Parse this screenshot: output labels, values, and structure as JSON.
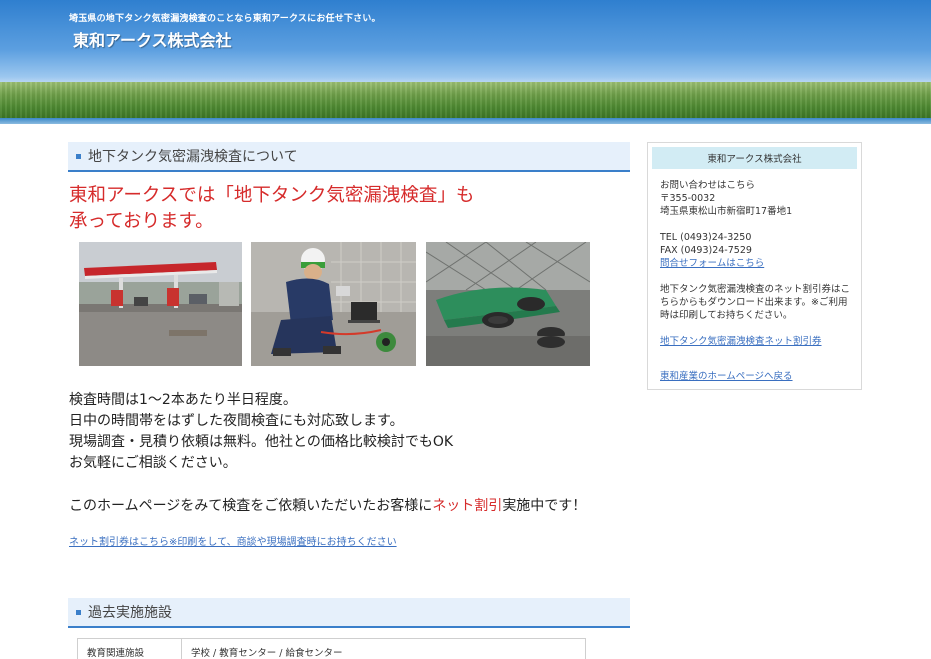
{
  "header": {
    "tagline": "埼玉県の地下タンク気密漏洩検査のことなら東和アークスにお任せ下さい。",
    "site_title": "東和アークス株式会社"
  },
  "main": {
    "section1_heading": "地下タンク気密漏洩検査について",
    "headline_line1": "東和アークスでは「地下タンク気密漏洩検査」も",
    "headline_line2": "承っております。",
    "photos": [
      {
        "name": "gas-station-photo"
      },
      {
        "name": "inspection-worker-photo"
      },
      {
        "name": "tank-covers-photo"
      }
    ],
    "body_lines": [
      "検査時間は1～2本あたり半日程度。",
      "日中の時間帯をはずした夜間検査にも対応致します。",
      "現場調査・見積り依頼は無料。他社との価格比較検討でもOK",
      "お気軽にご相談ください。"
    ],
    "promo_before": "このホームページをみて検査をご依頼いただいたお客様に",
    "promo_highlight": "ネット割引",
    "promo_after": "実施中です！",
    "coupon_link": "ネット割引券はこちら※印刷をして、商談や現場調査時にお持ちください",
    "section2_heading": "過去実施施設",
    "facilities": [
      {
        "category": "教育関連施設",
        "detail": "学校 / 教育センター / 給食センター"
      }
    ]
  },
  "sidebar": {
    "title": "東和アークス株式会社",
    "contact_label": "お問い合わせはこちら",
    "postal": "〒355-0032",
    "address": "埼玉県東松山市新宿町17番地1",
    "tel": "TEL (0493)24-3250",
    "fax": "FAX (0493)24-7529",
    "form_link": "問合せフォームはこちら",
    "coupon_note_1": "地下タンク気密漏洩検査のネット割引券はこ",
    "coupon_note_2": "ちらからもダウンロード出来ます。※ご利用",
    "coupon_note_3": "時は印刷してお持ちください。",
    "coupon_link": "地下タンク気密漏洩検査ネット割引券",
    "home_link": "東和産業のホームページへ戻る"
  },
  "colors": {
    "accent_blue": "#3a7fca",
    "headline_red": "#d62b2b",
    "link_blue": "#3a6fc0",
    "sidebar_title_bg": "#d2ecf4"
  }
}
